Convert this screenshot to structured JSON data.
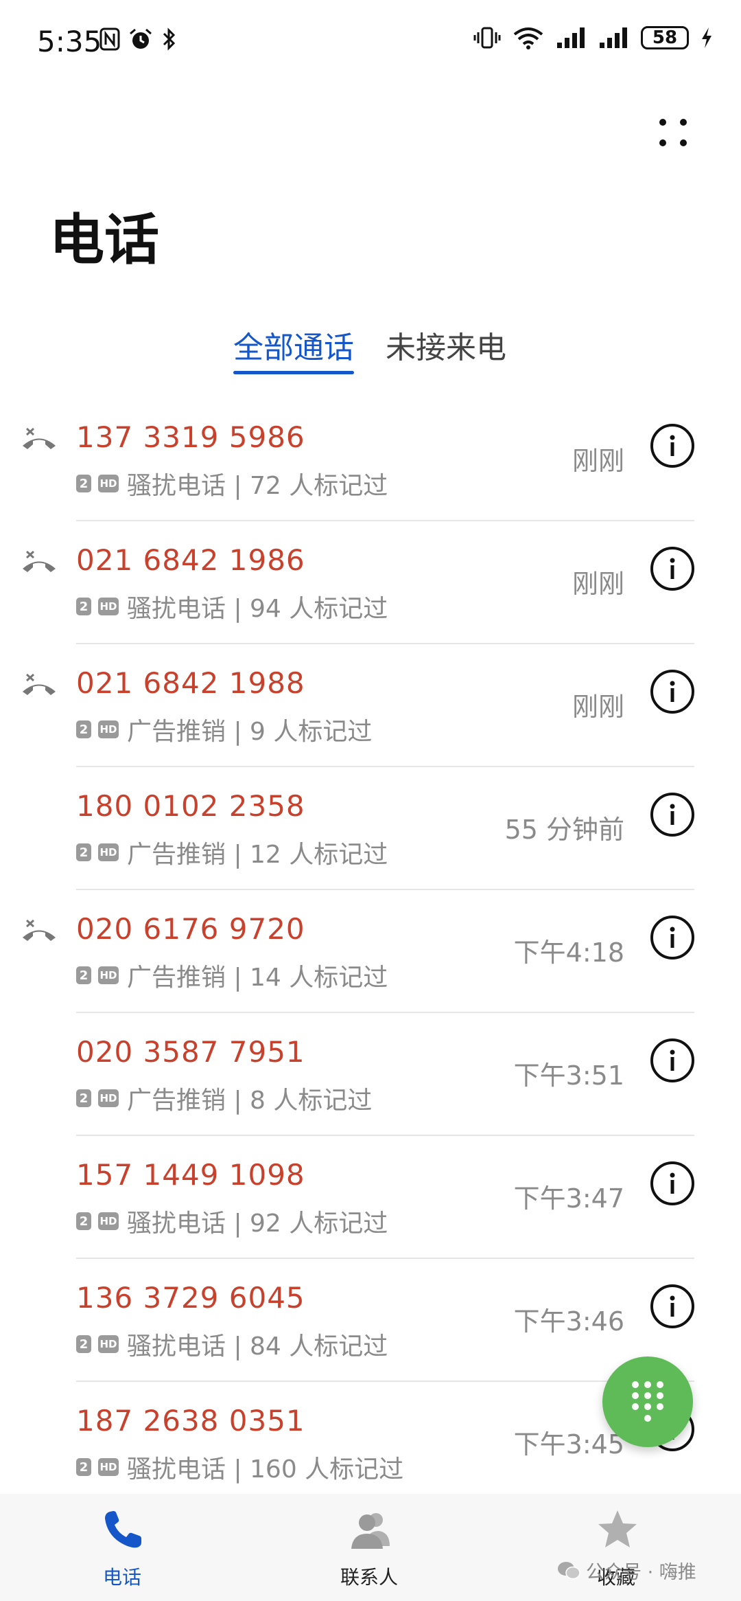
{
  "status_bar": {
    "time": "5:35",
    "battery": "58"
  },
  "page": {
    "title": "电话"
  },
  "tabs": [
    {
      "label": "全部通话",
      "active": true
    },
    {
      "label": "未接来电",
      "active": false
    }
  ],
  "calls": [
    {
      "number": "137 3319 5986",
      "desc": "骚扰电话 | 72 人标记过",
      "time": "刚刚",
      "missed": true
    },
    {
      "number": "021 6842 1986",
      "desc": "骚扰电话 | 94 人标记过",
      "time": "刚刚",
      "missed": true
    },
    {
      "number": "021 6842 1988",
      "desc": "广告推销 | 9 人标记过",
      "time": "刚刚",
      "missed": true
    },
    {
      "number": "180 0102 2358",
      "desc": "广告推销 | 12 人标记过",
      "time": "55 分钟前",
      "missed": false
    },
    {
      "number": "020 6176 9720",
      "desc": "广告推销 | 14 人标记过",
      "time": "下午4:18",
      "missed": true
    },
    {
      "number": "020 3587 7951",
      "desc": "广告推销 | 8 人标记过",
      "time": "下午3:51",
      "missed": false
    },
    {
      "number": "157 1449 1098",
      "desc": "骚扰电话 | 92 人标记过",
      "time": "下午3:47",
      "missed": false
    },
    {
      "number": "136 3729 6045",
      "desc": "骚扰电话 | 84 人标记过",
      "time": "下午3:46",
      "missed": false
    },
    {
      "number": "187 2638 0351",
      "desc": "骚扰电话 | 160 人标记过",
      "time": "下午3:45",
      "missed": false
    }
  ],
  "badges": {
    "sim": "2",
    "hd": "HD"
  },
  "bottom_nav": {
    "phone": "电话",
    "contacts": "联系人",
    "favorites": "收藏"
  },
  "watermark": "公众号 · 嗨推",
  "colors": {
    "accent": "#1557c8",
    "number_red": "#c8412c",
    "fab_green": "#5ebb57",
    "secondary_text": "#8a8a8a"
  }
}
